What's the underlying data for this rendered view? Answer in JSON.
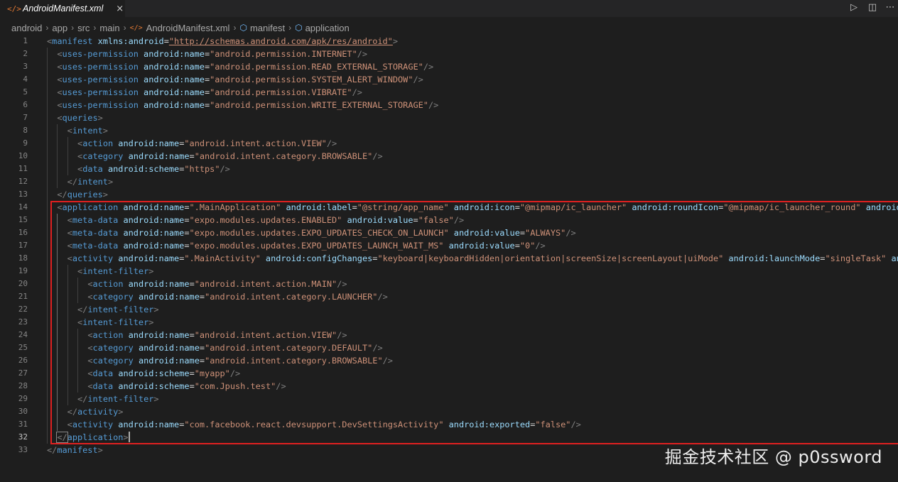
{
  "tab": {
    "icon": "xml-file-icon",
    "title": "AndroidManifest.xml",
    "close_glyph": "×"
  },
  "toolbar": {
    "run_glyph": "▷",
    "split_glyph": "◫",
    "more_glyph": "⋯"
  },
  "breadcrumb": {
    "items": [
      "android",
      "app",
      "src",
      "main",
      "AndroidManifest.xml",
      "manifest",
      "application"
    ],
    "separator": "›"
  },
  "editor": {
    "active_line": 32,
    "lines": [
      [
        [
          "p",
          "<"
        ],
        [
          "t",
          "manifest"
        ],
        [
          "a",
          " xmlns:android"
        ],
        [
          "e",
          "="
        ],
        [
          "l",
          "\"http://schemas.android.com/apk/res/android\""
        ],
        [
          "p",
          ">"
        ]
      ],
      [
        [
          "p",
          "<"
        ],
        [
          "t",
          "uses-permission"
        ],
        [
          "a",
          " android:name"
        ],
        [
          "e",
          "="
        ],
        [
          "s",
          "\"android.permission.INTERNET\""
        ],
        [
          "p",
          "/>"
        ]
      ],
      [
        [
          "p",
          "<"
        ],
        [
          "t",
          "uses-permission"
        ],
        [
          "a",
          " android:name"
        ],
        [
          "e",
          "="
        ],
        [
          "s",
          "\"android.permission.READ_EXTERNAL_STORAGE\""
        ],
        [
          "p",
          "/>"
        ]
      ],
      [
        [
          "p",
          "<"
        ],
        [
          "t",
          "uses-permission"
        ],
        [
          "a",
          " android:name"
        ],
        [
          "e",
          "="
        ],
        [
          "s",
          "\"android.permission.SYSTEM_ALERT_WINDOW\""
        ],
        [
          "p",
          "/>"
        ]
      ],
      [
        [
          "p",
          "<"
        ],
        [
          "t",
          "uses-permission"
        ],
        [
          "a",
          " android:name"
        ],
        [
          "e",
          "="
        ],
        [
          "s",
          "\"android.permission.VIBRATE\""
        ],
        [
          "p",
          "/>"
        ]
      ],
      [
        [
          "p",
          "<"
        ],
        [
          "t",
          "uses-permission"
        ],
        [
          "a",
          " android:name"
        ],
        [
          "e",
          "="
        ],
        [
          "s",
          "\"android.permission.WRITE_EXTERNAL_STORAGE\""
        ],
        [
          "p",
          "/>"
        ]
      ],
      [
        [
          "p",
          "<"
        ],
        [
          "t",
          "queries"
        ],
        [
          "p",
          ">"
        ]
      ],
      [
        [
          "p",
          "<"
        ],
        [
          "t",
          "intent"
        ],
        [
          "p",
          ">"
        ]
      ],
      [
        [
          "p",
          "<"
        ],
        [
          "t",
          "action"
        ],
        [
          "a",
          " android:name"
        ],
        [
          "e",
          "="
        ],
        [
          "s",
          "\"android.intent.action.VIEW\""
        ],
        [
          "p",
          "/>"
        ]
      ],
      [
        [
          "p",
          "<"
        ],
        [
          "t",
          "category"
        ],
        [
          "a",
          " android:name"
        ],
        [
          "e",
          "="
        ],
        [
          "s",
          "\"android.intent.category.BROWSABLE\""
        ],
        [
          "p",
          "/>"
        ]
      ],
      [
        [
          "p",
          "<"
        ],
        [
          "t",
          "data"
        ],
        [
          "a",
          " android:scheme"
        ],
        [
          "e",
          "="
        ],
        [
          "s",
          "\"https\""
        ],
        [
          "p",
          "/>"
        ]
      ],
      [
        [
          "p",
          "</"
        ],
        [
          "t",
          "intent"
        ],
        [
          "p",
          ">"
        ]
      ],
      [
        [
          "p",
          "</"
        ],
        [
          "t",
          "queries"
        ],
        [
          "p",
          ">"
        ]
      ],
      [
        [
          "p",
          "<"
        ],
        [
          "t",
          "application"
        ],
        [
          "a",
          " android:name"
        ],
        [
          "e",
          "="
        ],
        [
          "s",
          "\".MainApplication\""
        ],
        [
          "a",
          " android:label"
        ],
        [
          "e",
          "="
        ],
        [
          "s",
          "\"@string/app_name\""
        ],
        [
          "a",
          " android:icon"
        ],
        [
          "e",
          "="
        ],
        [
          "s",
          "\"@mipmap/ic_launcher\""
        ],
        [
          "a",
          " android:roundIcon"
        ],
        [
          "e",
          "="
        ],
        [
          "s",
          "\"@mipmap/ic_launcher_round\""
        ],
        [
          "a",
          " android:"
        ]
      ],
      [
        [
          "p",
          "<"
        ],
        [
          "t",
          "meta-data"
        ],
        [
          "a",
          " android:name"
        ],
        [
          "e",
          "="
        ],
        [
          "s",
          "\"expo.modules.updates.ENABLED\""
        ],
        [
          "a",
          " android:value"
        ],
        [
          "e",
          "="
        ],
        [
          "s",
          "\"false\""
        ],
        [
          "p",
          "/>"
        ]
      ],
      [
        [
          "p",
          "<"
        ],
        [
          "t",
          "meta-data"
        ],
        [
          "a",
          " android:name"
        ],
        [
          "e",
          "="
        ],
        [
          "s",
          "\"expo.modules.updates.EXPO_UPDATES_CHECK_ON_LAUNCH\""
        ],
        [
          "a",
          " android:value"
        ],
        [
          "e",
          "="
        ],
        [
          "s",
          "\"ALWAYS\""
        ],
        [
          "p",
          "/>"
        ]
      ],
      [
        [
          "p",
          "<"
        ],
        [
          "t",
          "meta-data"
        ],
        [
          "a",
          " android:name"
        ],
        [
          "e",
          "="
        ],
        [
          "s",
          "\"expo.modules.updates.EXPO_UPDATES_LAUNCH_WAIT_MS\""
        ],
        [
          "a",
          " android:value"
        ],
        [
          "e",
          "="
        ],
        [
          "s",
          "\"0\""
        ],
        [
          "p",
          "/>"
        ]
      ],
      [
        [
          "p",
          "<"
        ],
        [
          "t",
          "activity"
        ],
        [
          "a",
          " android:name"
        ],
        [
          "e",
          "="
        ],
        [
          "s",
          "\".MainActivity\""
        ],
        [
          "a",
          " android:configChanges"
        ],
        [
          "e",
          "="
        ],
        [
          "s",
          "\"keyboard|keyboardHidden|orientation|screenSize|screenLayout|uiMode\""
        ],
        [
          "a",
          " android:launchMode"
        ],
        [
          "e",
          "="
        ],
        [
          "s",
          "\"singleTask\""
        ],
        [
          "a",
          " an"
        ]
      ],
      [
        [
          "p",
          "<"
        ],
        [
          "t",
          "intent-filter"
        ],
        [
          "p",
          ">"
        ]
      ],
      [
        [
          "p",
          "<"
        ],
        [
          "t",
          "action"
        ],
        [
          "a",
          " android:name"
        ],
        [
          "e",
          "="
        ],
        [
          "s",
          "\"android.intent.action.MAIN\""
        ],
        [
          "p",
          "/>"
        ]
      ],
      [
        [
          "p",
          "<"
        ],
        [
          "t",
          "category"
        ],
        [
          "a",
          " android:name"
        ],
        [
          "e",
          "="
        ],
        [
          "s",
          "\"android.intent.category.LAUNCHER\""
        ],
        [
          "p",
          "/>"
        ]
      ],
      [
        [
          "p",
          "</"
        ],
        [
          "t",
          "intent-filter"
        ],
        [
          "p",
          ">"
        ]
      ],
      [
        [
          "p",
          "<"
        ],
        [
          "t",
          "intent-filter"
        ],
        [
          "p",
          ">"
        ]
      ],
      [
        [
          "p",
          "<"
        ],
        [
          "t",
          "action"
        ],
        [
          "a",
          " android:name"
        ],
        [
          "e",
          "="
        ],
        [
          "s",
          "\"android.intent.action.VIEW\""
        ],
        [
          "p",
          "/>"
        ]
      ],
      [
        [
          "p",
          "<"
        ],
        [
          "t",
          "category"
        ],
        [
          "a",
          " android:name"
        ],
        [
          "e",
          "="
        ],
        [
          "s",
          "\"android.intent.category.DEFAULT\""
        ],
        [
          "p",
          "/>"
        ]
      ],
      [
        [
          "p",
          "<"
        ],
        [
          "t",
          "category"
        ],
        [
          "a",
          " android:name"
        ],
        [
          "e",
          "="
        ],
        [
          "s",
          "\"android.intent.category.BROWSABLE\""
        ],
        [
          "p",
          "/>"
        ]
      ],
      [
        [
          "p",
          "<"
        ],
        [
          "t",
          "data"
        ],
        [
          "a",
          " android:scheme"
        ],
        [
          "e",
          "="
        ],
        [
          "s",
          "\"myapp\""
        ],
        [
          "p",
          "/>"
        ]
      ],
      [
        [
          "p",
          "<"
        ],
        [
          "t",
          "data"
        ],
        [
          "a",
          " android:scheme"
        ],
        [
          "e",
          "="
        ],
        [
          "s",
          "\"com.Jpush.test\""
        ],
        [
          "p",
          "/>"
        ]
      ],
      [
        [
          "p",
          "</"
        ],
        [
          "t",
          "intent-filter"
        ],
        [
          "p",
          ">"
        ]
      ],
      [
        [
          "p",
          "</"
        ],
        [
          "t",
          "activity"
        ],
        [
          "p",
          ">"
        ]
      ],
      [
        [
          "p",
          "<"
        ],
        [
          "t",
          "activity"
        ],
        [
          "a",
          " android:name"
        ],
        [
          "e",
          "="
        ],
        [
          "s",
          "\"com.facebook.react.devsupport.DevSettingsActivity\""
        ],
        [
          "a",
          " android:exported"
        ],
        [
          "e",
          "="
        ],
        [
          "s",
          "\"false\""
        ],
        [
          "p",
          "/>"
        ]
      ],
      [
        [
          "p",
          "</"
        ],
        [
          "t",
          "application"
        ],
        [
          "p",
          ">"
        ]
      ],
      [
        [
          "p",
          "</"
        ],
        [
          "t",
          "manifest"
        ],
        [
          "p",
          ">"
        ]
      ]
    ]
  },
  "watermark": "掘金技术社区 @ p0ssword",
  "colors": {
    "background": "#1e1e1e",
    "tag": "#569cd6",
    "attribute": "#9cdcfe",
    "string": "#ce9178",
    "punctuation": "#808080",
    "highlight_box": "#e02020"
  }
}
